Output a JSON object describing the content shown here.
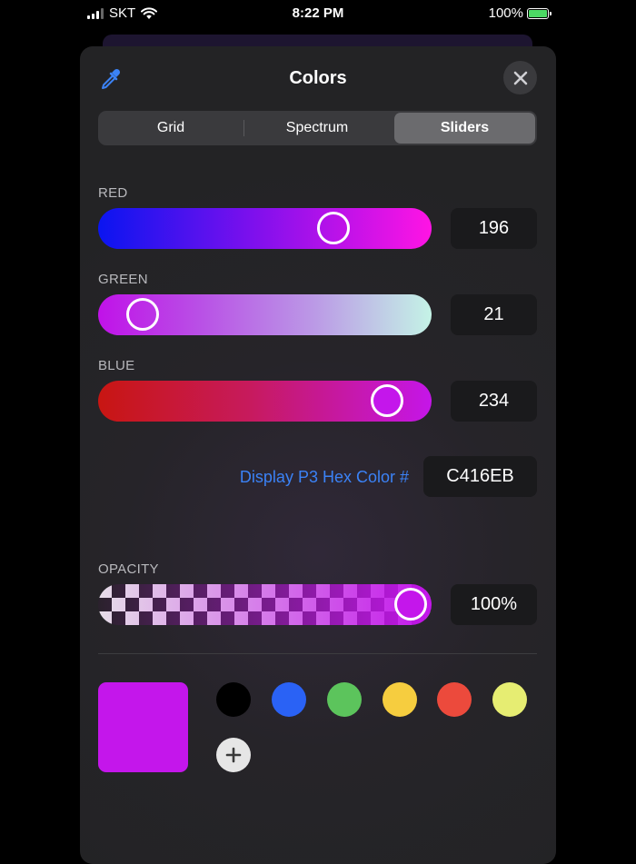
{
  "status_bar": {
    "carrier": "SKT",
    "time": "8:22 PM",
    "battery": "100%"
  },
  "header": {
    "title": "Colors"
  },
  "segments": [
    {
      "label": "Grid",
      "active": false
    },
    {
      "label": "Spectrum",
      "active": false
    },
    {
      "label": "Sliders",
      "active": true
    }
  ],
  "sliders": {
    "red": {
      "label": "RED",
      "value": "196",
      "level": 0.735
    },
    "green": {
      "label": "GREEN",
      "value": "21",
      "level": 0.08
    },
    "blue": {
      "label": "BLUE",
      "value": "234",
      "level": 0.92
    }
  },
  "hex": {
    "label": "Display P3 Hex Color #",
    "value": "C416EB"
  },
  "opacity": {
    "label": "OPACITY",
    "value": "100%",
    "level": 1.0
  },
  "current_color": "#c416eb",
  "swatches": [
    {
      "name": "black",
      "color": "#000000"
    },
    {
      "name": "blue",
      "color": "#2a62f5"
    },
    {
      "name": "green",
      "color": "#5cc45c"
    },
    {
      "name": "yellow",
      "color": "#f6cd3f"
    },
    {
      "name": "red",
      "color": "#ec4a3c"
    },
    {
      "name": "light-yellow",
      "color": "#e6ed72"
    }
  ],
  "accent_color": "#3b82f6"
}
